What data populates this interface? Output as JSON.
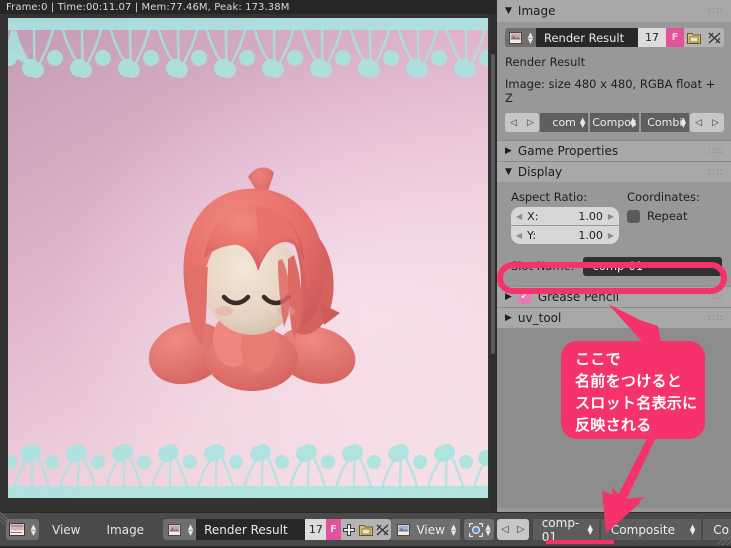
{
  "editor": {
    "stats": "Frame:0 | Time:00:11.07 | Mem:77.46M, Peak: 173.38M",
    "image_description": "3D chibi character with pink hair, pink gradient background, teal lace borders"
  },
  "properties": {
    "image_panel": {
      "title": "Image",
      "datablock": {
        "icon": "image-icon",
        "name": "Render Result",
        "users": "17",
        "fake_user": "F",
        "save_icon": "save-icon",
        "unlink_icon": "unlink-icon"
      },
      "source_label": "Render Result",
      "info_label": "Image: size 480 x 480, RGBA float + Z",
      "layer_row": {
        "prev": "◁",
        "next": "▷",
        "slot": "com",
        "layer": "Compos",
        "pass": "Combi"
      }
    },
    "game_properties": {
      "title": "Game Properties"
    },
    "display": {
      "title": "Display",
      "aspect_label": "Aspect Ratio:",
      "aspect_x_key": "X:",
      "aspect_x_value": "1.00",
      "aspect_y_key": "Y:",
      "aspect_y_value": "1.00",
      "coordinates_label": "Coordinates:",
      "repeat_label": "Repeat",
      "slot_name_label": "Slot Name:",
      "slot_name_value": "comp-01"
    },
    "grease_pencil": {
      "title": "Grease Pencil",
      "checked": true
    },
    "uv_tool": {
      "title": "uv_tool"
    }
  },
  "bottom_bar": {
    "editor_type_icon": "image-editor-icon",
    "menus": [
      "View",
      "Image"
    ],
    "datablock": {
      "icon": "image-icon",
      "name": "Render Result",
      "users": "17",
      "fake_user": "F",
      "new_icon": "plus-icon",
      "open_icon": "open-icon",
      "unlink_icon": "unlink-icon"
    },
    "view_mode": "View",
    "pivot_icon": "pivot-icon",
    "prev": "◁",
    "next": "▷",
    "slot": "comp-01",
    "layer": "Composite",
    "pass": "Co"
  },
  "annotation": {
    "lines": [
      "ここで",
      "名前をつけると",
      "スロット名表示に",
      "反映される"
    ],
    "color": "#f5336a"
  }
}
